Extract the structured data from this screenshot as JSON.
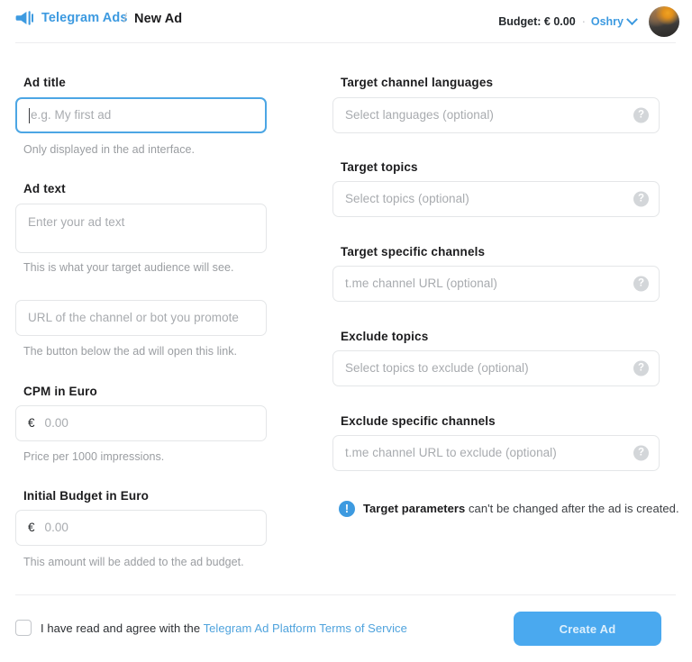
{
  "header": {
    "logo_icon": "megaphone-icon",
    "brand": "Telegram Ads",
    "separator": "/",
    "current_page": "New Ad",
    "budget_label": "Budget: € 0.00",
    "dot": "·",
    "user_name": "Oshry",
    "chevron_icon": "chevron-down-icon",
    "avatar_icon": "user-avatar"
  },
  "left_column": {
    "ad_title": {
      "label": "Ad title",
      "placeholder": "e.g. My first ad",
      "value": "",
      "hint": "Only displayed in the ad interface.",
      "focused": true
    },
    "ad_text": {
      "label": "Ad text",
      "placeholder": "Enter your ad text",
      "value": "",
      "hint": "This is what your target audience will see."
    },
    "ad_url": {
      "label": "",
      "placeholder": "URL of the channel or bot you promote",
      "value": "",
      "hint": "The button below the ad will open this link."
    },
    "cpm": {
      "label": "CPM in Euro",
      "currency": "€",
      "placeholder": "0.00",
      "value": "",
      "hint": "Price per 1000 impressions."
    },
    "initial_budget": {
      "label": "Initial Budget in Euro",
      "currency": "€",
      "placeholder": "0.00",
      "value": "",
      "hint": "This amount will be added to the ad budget."
    }
  },
  "right_column": {
    "help_glyph": "?",
    "fields": [
      {
        "label": "Target channel languages",
        "placeholder": "Select languages (optional)",
        "value": ""
      },
      {
        "label": "Target topics",
        "placeholder": "Select topics (optional)",
        "value": ""
      },
      {
        "label": "Target specific channels",
        "placeholder": "t.me channel URL (optional)",
        "value": ""
      },
      {
        "label": "Exclude topics",
        "placeholder": "Select topics to exclude (optional)",
        "value": ""
      },
      {
        "label": "Exclude specific channels",
        "placeholder": "t.me channel URL to exclude (optional)",
        "value": ""
      }
    ],
    "notice": {
      "icon": "info-icon",
      "glyph": "!",
      "bold_part": "Target parameters",
      "rest": " can't be changed after the ad is created."
    }
  },
  "footer": {
    "checkbox_checked": false,
    "agree_text": "I have read and agree with the ",
    "terms_link": "Telegram Ad Platform Terms of Service",
    "create_button": "Create Ad"
  },
  "colors": {
    "accent": "#3d9ae0",
    "button": "#4aa9ef",
    "focus_border": "#4ca6e4",
    "border": "#e4e6e8",
    "placeholder": "#a8abaf",
    "hint": "#9a9da1",
    "text": "#1c1c1e",
    "link": "#4fa3dd",
    "help_bg": "#d3d6d9"
  }
}
